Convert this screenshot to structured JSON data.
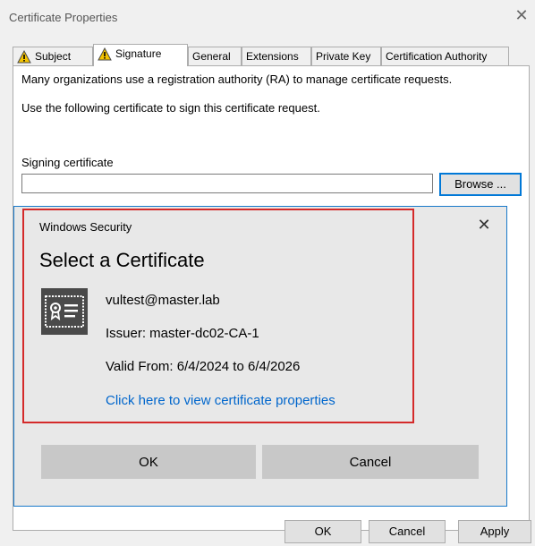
{
  "window": {
    "title": "Certificate Properties",
    "close_glyph": "✕"
  },
  "tabs": [
    {
      "label": "Subject",
      "warning": true
    },
    {
      "label": "Signature",
      "warning": true,
      "active": true
    },
    {
      "label": "General"
    },
    {
      "label": "Extensions"
    },
    {
      "label": "Private Key"
    },
    {
      "label": "Certification Authority"
    }
  ],
  "signature": {
    "intro": "Many organizations use a registration authority (RA) to manage certificate requests.",
    "instruction": "Use the following certificate to sign this certificate request.",
    "signing_label": "Signing certificate",
    "signing_value": "",
    "browse_label": "Browse ..."
  },
  "security_dialog": {
    "title": "Windows Security",
    "close_glyph": "✕",
    "heading": "Select a Certificate",
    "cert_name": "vultest@master.lab",
    "issuer": "Issuer: master-dc02-CA-1",
    "valid": "Valid From: 6/4/2024 to 6/4/2026",
    "link": "Click here to view certificate properties",
    "ok_label": "OK",
    "cancel_label": "Cancel",
    "icon": "certificate-icon",
    "highlight_color": "#d42a2a",
    "link_color": "#0066cc"
  },
  "footer": {
    "ok_label": "OK",
    "cancel_label": "Cancel",
    "apply_label": "Apply"
  }
}
